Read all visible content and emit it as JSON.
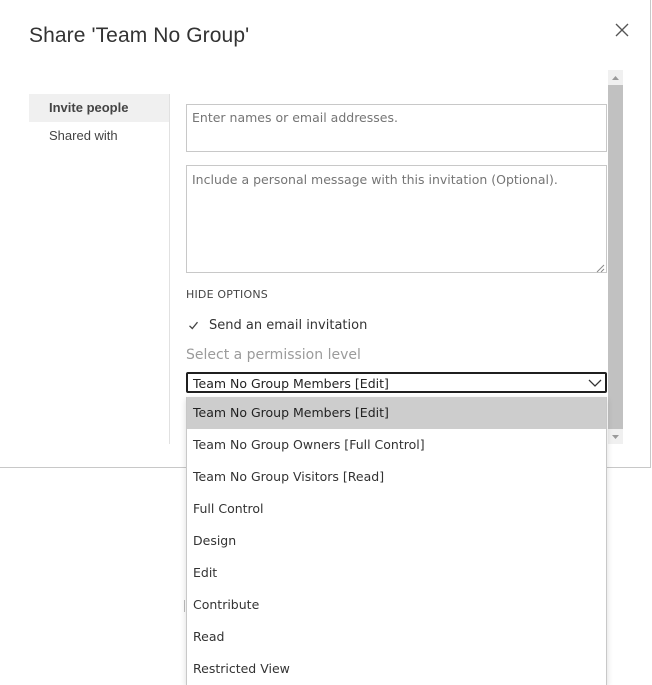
{
  "dialog": {
    "title": "Share 'Team No Group'",
    "close_icon": "close-icon"
  },
  "nav": {
    "items": [
      {
        "label": "Invite people",
        "selected": true
      },
      {
        "label": "Shared with",
        "selected": false
      }
    ]
  },
  "form": {
    "names_placeholder": "Enter names or email addresses.",
    "message_placeholder": "Include a personal message with this invitation (Optional).",
    "hide_options_label": "HIDE OPTIONS",
    "send_email": {
      "label": "Send an email invitation",
      "checked": true
    },
    "permission_label": "Select a permission level",
    "permission_selected": "Team No Group Members [Edit]"
  },
  "dropdown": {
    "options": [
      "Team No Group Members [Edit]",
      "Team No Group Owners [Full Control]",
      "Team No Group Visitors [Read]",
      "Full Control",
      "Design",
      "Edit",
      "Contribute",
      "Read",
      "Restricted View"
    ],
    "highlighted_index": 0
  },
  "colors": {
    "highlight": "#cdcdcd",
    "select_border": "#1f1f1f",
    "scroll_thumb": "#c1c1c1"
  }
}
